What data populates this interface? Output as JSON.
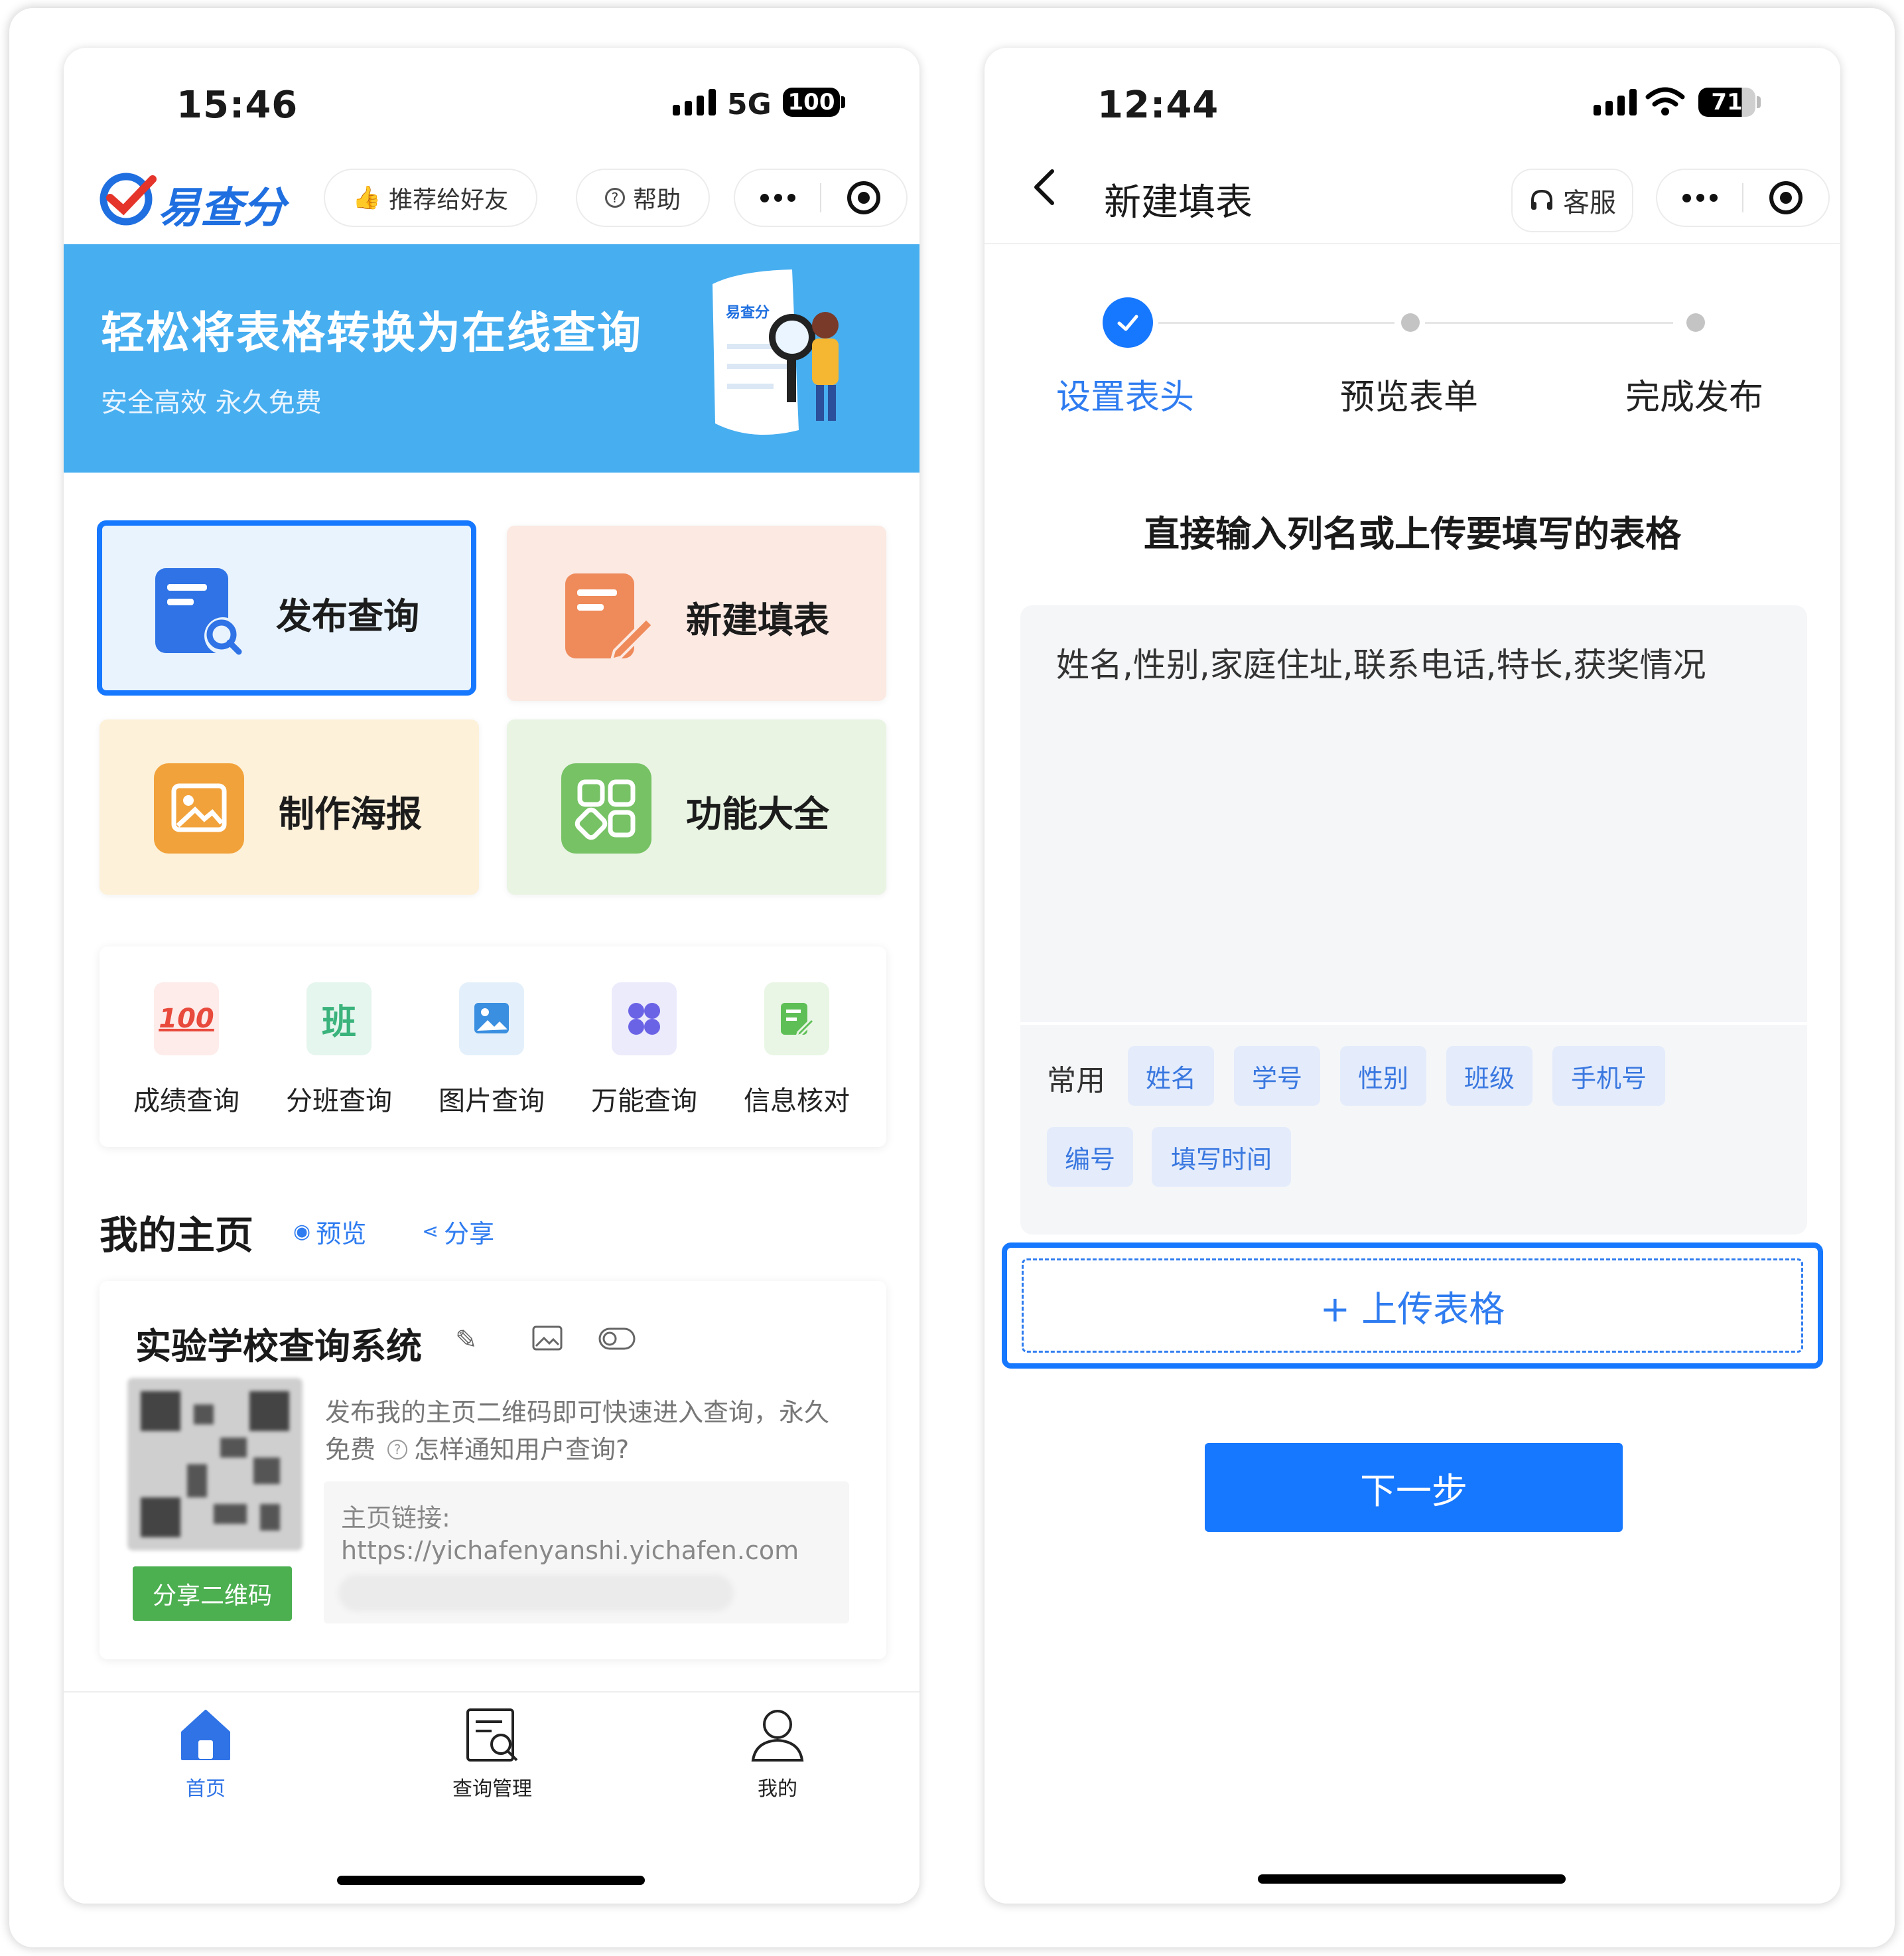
{
  "left_phone": {
    "status": {
      "time": "15:46",
      "network": "5G",
      "battery": "100"
    },
    "header": {
      "logo_text": "易查分",
      "recommend_label": "推荐给好友",
      "help_label": "帮助"
    },
    "banner": {
      "title": "轻松将表格转换为在线查询",
      "subtitle": "安全高效 永久免费",
      "illustration_logo": "易查分"
    },
    "tiles": [
      {
        "label": "发布查询",
        "icon": "search-document-icon"
      },
      {
        "label": "新建填表",
        "icon": "edit-form-icon"
      },
      {
        "label": "制作海报",
        "icon": "image-poster-icon"
      },
      {
        "label": "功能大全",
        "icon": "grid-apps-icon"
      }
    ],
    "quick_items": [
      {
        "label": "成绩查询",
        "badge": "100"
      },
      {
        "label": "分班查询",
        "badge": "班"
      },
      {
        "label": "图片查询",
        "badge": ""
      },
      {
        "label": "万能查询",
        "badge": ""
      },
      {
        "label": "信息核对",
        "badge": ""
      }
    ],
    "homepage": {
      "title": "我的主页",
      "preview_label": "预览",
      "share_label": "分享",
      "system_name": "实验学校查询系统",
      "desc_line1": "发布我的主页二维码即可快速进入查询，永久",
      "desc_line2": "免费",
      "notify_help": "怎样通知用户查询?",
      "link_label": "主页链接:",
      "link_url": "https://yichafenyanshi.yichafen.com",
      "share_qr_label": "分享二维码"
    },
    "tabs": [
      {
        "label": "首页",
        "active": true
      },
      {
        "label": "查询管理",
        "active": false
      },
      {
        "label": "我的",
        "active": false
      }
    ]
  },
  "right_phone": {
    "status": {
      "time": "12:44",
      "battery": "71"
    },
    "header": {
      "title": "新建填表",
      "service_label": "客服"
    },
    "steps": [
      {
        "label": "设置表头",
        "state": "done"
      },
      {
        "label": "预览表单",
        "state": "pending"
      },
      {
        "label": "完成发布",
        "state": "pending"
      }
    ],
    "instruction": "直接输入列名或上传要填写的表格",
    "columns_value": "姓名,性别,家庭住址,联系电话,特长,获奖情况",
    "common_label": "常用",
    "chips": [
      "姓名",
      "学号",
      "性别",
      "班级",
      "手机号",
      "编号",
      "填写时间"
    ],
    "upload_label": "+ 上传表格",
    "next_label": "下一步"
  },
  "colors": {
    "brand_blue": "#1677ff",
    "banner_blue": "#47aef0",
    "link_blue": "#2f7cf0",
    "green": "#4caf50",
    "highlight_border": "#1677ff"
  }
}
